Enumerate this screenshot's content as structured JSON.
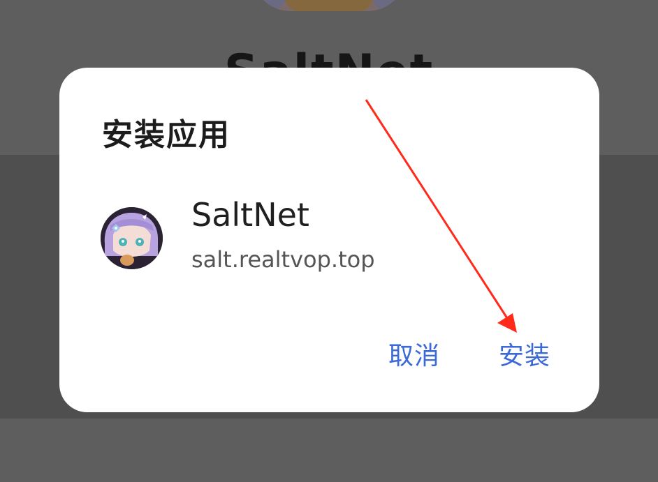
{
  "background": {
    "title": "SaltNet"
  },
  "dialog": {
    "title": "安装应用",
    "app": {
      "name": "SaltNet",
      "host": "salt.realtvop.top",
      "icon": "app-avatar-icon"
    },
    "actions": {
      "cancel_label": "取消",
      "install_label": "安装"
    }
  },
  "colors": {
    "scrim": "#5d5d5d",
    "dialog_bg": "#ffffff",
    "accent": "#3b69d6",
    "annotation_arrow": "#ff2a1a"
  }
}
